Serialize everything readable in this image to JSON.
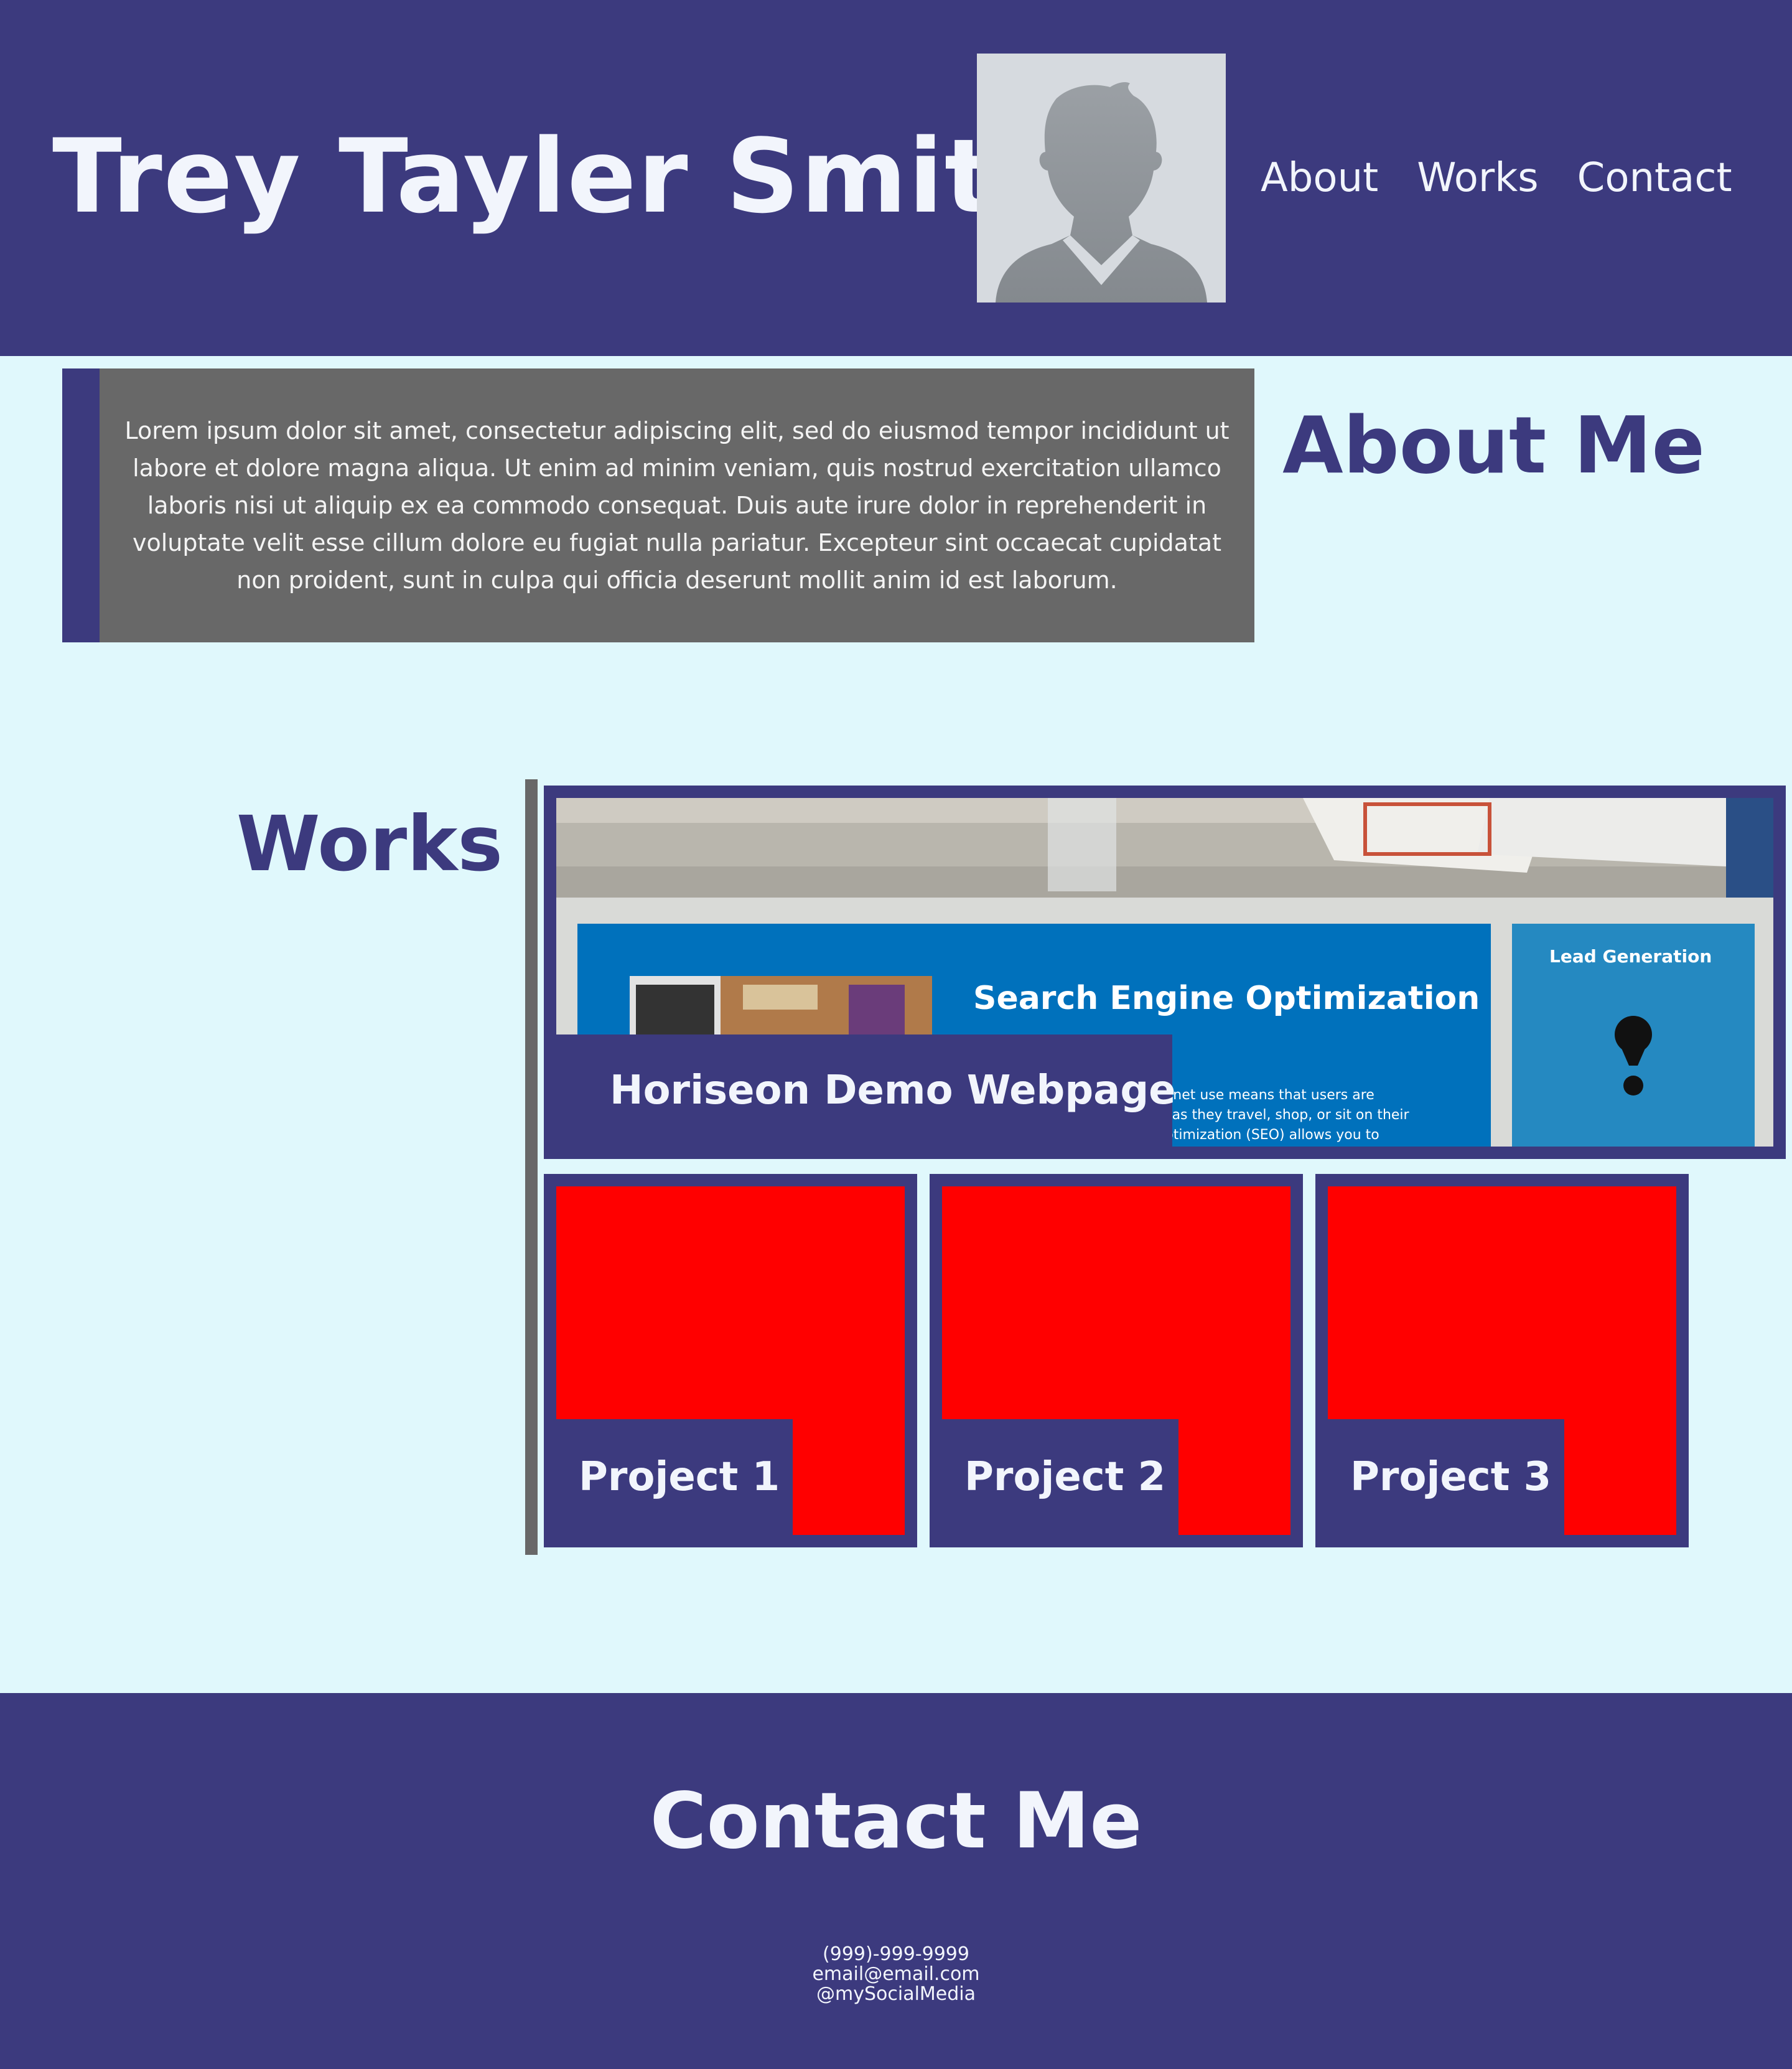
{
  "header": {
    "name": "Trey Tayler Smith",
    "nav": [
      "About",
      "Works",
      "Contact"
    ]
  },
  "about": {
    "heading": "About Me",
    "text": "Lorem ipsum dolor sit amet, consectetur adipiscing elit, sed do eiusmod tempor incididunt ut labore et dolore magna aliqua. Ut enim ad minim veniam, quis nostrud exercitation ullamco laboris nisi ut aliquip ex ea commodo consequat. Duis aute irure dolor in reprehenderit in voluptate velit esse cillum dolore eu fugiat nulla pariatur. Excepteur sint occaecat cupidatat non proident, sunt in culpa qui officia deserunt mollit anim id est laborum."
  },
  "works": {
    "heading": "Works",
    "featured": {
      "label": "Horiseon Demo Webpage",
      "screenshot": {
        "headline": "Search Engine Optimization",
        "sidebar_title": "Lead Generation",
        "body": [
          "Internet use means that users are",
          "less as they travel, shop, or sit on their",
          "e Optimization (SEO) allows you to"
        ]
      }
    },
    "projects": [
      {
        "label": "Project 1"
      },
      {
        "label": "Project 2"
      },
      {
        "label": "Project 3"
      }
    ]
  },
  "contact": {
    "heading": "Contact Me",
    "phone": "(999)-999-9999",
    "email": "email@email.com",
    "social": "@mySocialMedia"
  },
  "colors": {
    "primary": "#3c3a7e",
    "background": "#e0f8fc",
    "about_box": "#686868",
    "project_placeholder": "#ff0000",
    "text_light": "#f2f5fc"
  }
}
